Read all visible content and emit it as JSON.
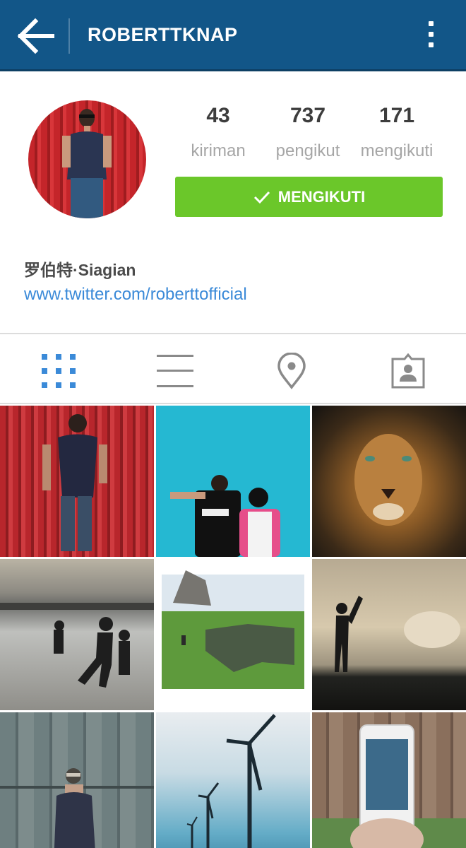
{
  "header": {
    "title": "ROBERTTKNAP",
    "back_icon": "arrow-left-icon",
    "menu_icon": "more-vertical-icon",
    "bar_color": "#125688"
  },
  "profile": {
    "stats": [
      {
        "value": "43",
        "label": "kiriman"
      },
      {
        "value": "737",
        "label": "pengikut"
      },
      {
        "value": "171",
        "label": "mengikuti"
      }
    ],
    "follow_button": {
      "label": "MENGIKUTI",
      "icon": "check-icon",
      "color": "#6bc72a"
    },
    "full_name": "罗伯特·Siagian",
    "website": "www.twitter.com/roberttofficial",
    "link_color": "#3b8ad8"
  },
  "tabs": [
    {
      "name": "grid-view",
      "icon": "grid-icon",
      "active": true
    },
    {
      "name": "list-view",
      "icon": "list-icon",
      "active": false
    },
    {
      "name": "photo-map",
      "icon": "location-pin-icon",
      "active": false
    },
    {
      "name": "photos-of-you",
      "icon": "tagged-person-icon",
      "active": false
    }
  ],
  "grid": [
    {
      "subject": "man-red-wall"
    },
    {
      "subject": "couple-blue-wall"
    },
    {
      "subject": "lion"
    },
    {
      "subject": "beach-silhouettes"
    },
    {
      "subject": "green-hill"
    },
    {
      "subject": "silhouette-sky"
    },
    {
      "subject": "man-wood-wall"
    },
    {
      "subject": "wind-turbines"
    },
    {
      "subject": "phone-in-hand"
    }
  ]
}
